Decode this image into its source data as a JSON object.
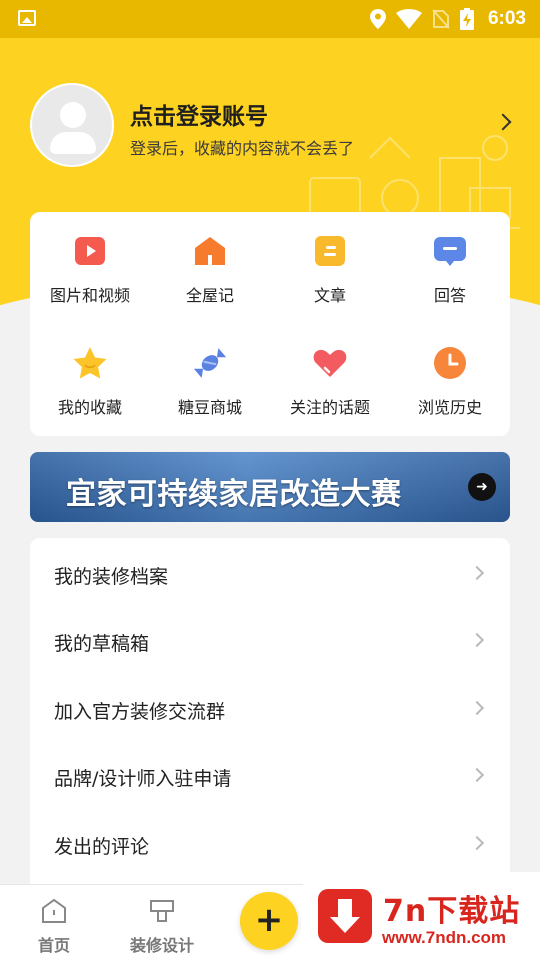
{
  "status_bar": {
    "time": "6:03",
    "icons": [
      "gallery-icon",
      "location-icon",
      "wifi-icon",
      "no-sim-icon",
      "battery-charging-icon"
    ]
  },
  "profile": {
    "title": "点击登录账号",
    "subtitle": "登录后，收藏的内容就不会丢了"
  },
  "shortcuts": [
    {
      "label": "图片和视频",
      "icon": "video-icon",
      "color": "#f45a4e"
    },
    {
      "label": "全屋记",
      "icon": "house-icon",
      "color": "#f77b2c"
    },
    {
      "label": "文章",
      "icon": "article-icon",
      "color": "#f9b92c"
    },
    {
      "label": "回答",
      "icon": "answer-icon",
      "color": "#5c87e6"
    },
    {
      "label": "我的收藏",
      "icon": "star-icon",
      "color": "#fbc52a"
    },
    {
      "label": "糖豆商城",
      "icon": "candy-icon",
      "color": "#5b82e3"
    },
    {
      "label": "关注的话题",
      "icon": "heart-icon",
      "color": "#f25b5f"
    },
    {
      "label": "浏览历史",
      "icon": "clock-icon",
      "color": "#f7863a"
    }
  ],
  "banner": {
    "text": "宜家可持续家居改造大赛",
    "close": "✕",
    "arrow": "➜"
  },
  "menu": [
    {
      "label": "我的装修档案"
    },
    {
      "label": "我的草稿箱"
    },
    {
      "label": "加入官方装修交流群"
    },
    {
      "label": "品牌/设计师入驻申请"
    },
    {
      "label": "发出的评论"
    }
  ],
  "bottom_nav": {
    "home": "首页",
    "design": "装修设计",
    "fab": "+"
  },
  "watermark": {
    "title": "7n下载站",
    "url": "www.7ndn.com"
  },
  "colors": {
    "brand_yellow": "#fdd221",
    "status_bar": "#e8b800"
  }
}
